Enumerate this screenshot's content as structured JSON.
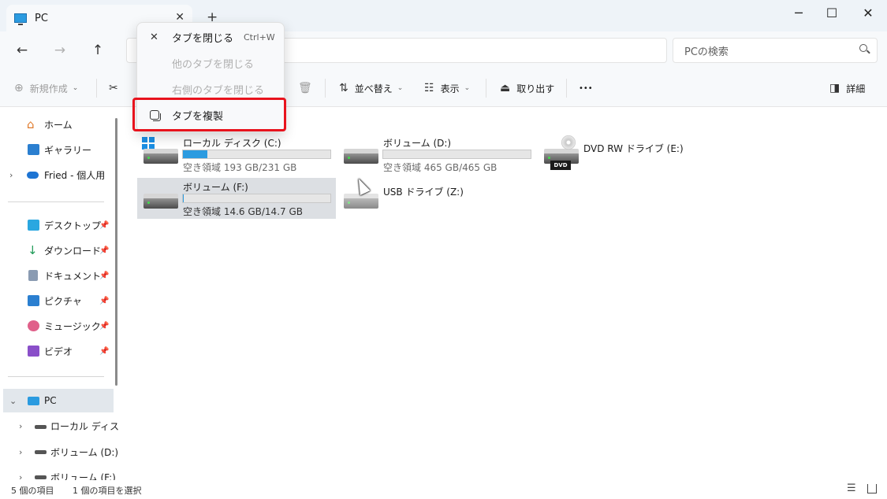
{
  "window": {
    "tab_title": "PC",
    "tab_close": "✕",
    "new_tab": "+",
    "minimize": "─",
    "maximize": "☐",
    "close": "✕"
  },
  "nav": {
    "back": "←",
    "forward": "→",
    "up": "↑",
    "refresh": "⟳",
    "search_placeholder": "PCの検索"
  },
  "toolbar": {
    "new_label": "新規作成",
    "cut_icon": "✂",
    "delete_icon": "🗑",
    "sort_label": "並べ替え",
    "view_label": "表示",
    "eject_label": "取り出す",
    "more": "•••",
    "details_label": "詳細"
  },
  "sidebar": {
    "home": "ホーム",
    "gallery": "ギャラリー",
    "onedrive": "Fried - 個人用",
    "desktop": "デスクトップ",
    "downloads": "ダウンロード",
    "documents": "ドキュメント",
    "pictures": "ピクチャ",
    "music": "ミュージック",
    "videos": "ビデオ",
    "pc": "PC",
    "drive_c": "ローカル ディスク",
    "drive_d": "ボリューム (D:)",
    "drive_f": "ボリューム (F:)"
  },
  "drives": [
    {
      "name": "ローカル ディスク (C:)",
      "space": "空き領域 193 GB/231 GB",
      "used_fraction": 0.165
    },
    {
      "name": "ボリューム (D:)",
      "space": "空き領域 465 GB/465 GB",
      "used_fraction": 0.0
    },
    {
      "name": "DVD RW ドライブ (E:)",
      "badge": "DVD"
    },
    {
      "name": "ボリューム (F:)",
      "space": "空き領域 14.6 GB/14.7 GB",
      "used_fraction": 0.007
    },
    {
      "name": "USB ドライブ (Z:)"
    }
  ],
  "status": {
    "item_count": "5 個の項目",
    "selected": "1 個の項目を選択"
  },
  "context_menu": {
    "close_tab": "タブを閉じる",
    "close_tab_shortcut": "Ctrl+W",
    "close_other_tabs": "他のタブを閉じる",
    "close_right_tabs": "右側のタブを閉じる",
    "duplicate_tab": "タブを複製"
  },
  "colors": {
    "accent": "#2b9be0",
    "highlight_border": "#e8131d"
  }
}
